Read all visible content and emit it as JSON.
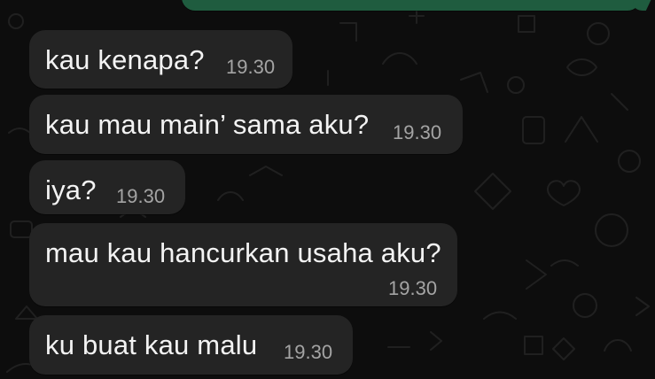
{
  "chat": {
    "messages": [
      {
        "text": "kau kenapa?",
        "time": "19.30"
      },
      {
        "text": "kau mau main’ sama aku?",
        "time": "19.30"
      },
      {
        "text": "iya?",
        "time": "19.30"
      },
      {
        "text": "mau kau hancurkan usaha aku?",
        "time": "19.30"
      },
      {
        "text": "ku buat kau malu",
        "time": "19.30"
      }
    ]
  },
  "theme": {
    "incoming_bubble": "#242424",
    "outgoing_bubble": "#1f5c3f",
    "background": "#0d0d0d",
    "timestamp": "#a4a4a4"
  },
  "icons": {
    "wallpaper": "chat-doodle-pattern"
  }
}
